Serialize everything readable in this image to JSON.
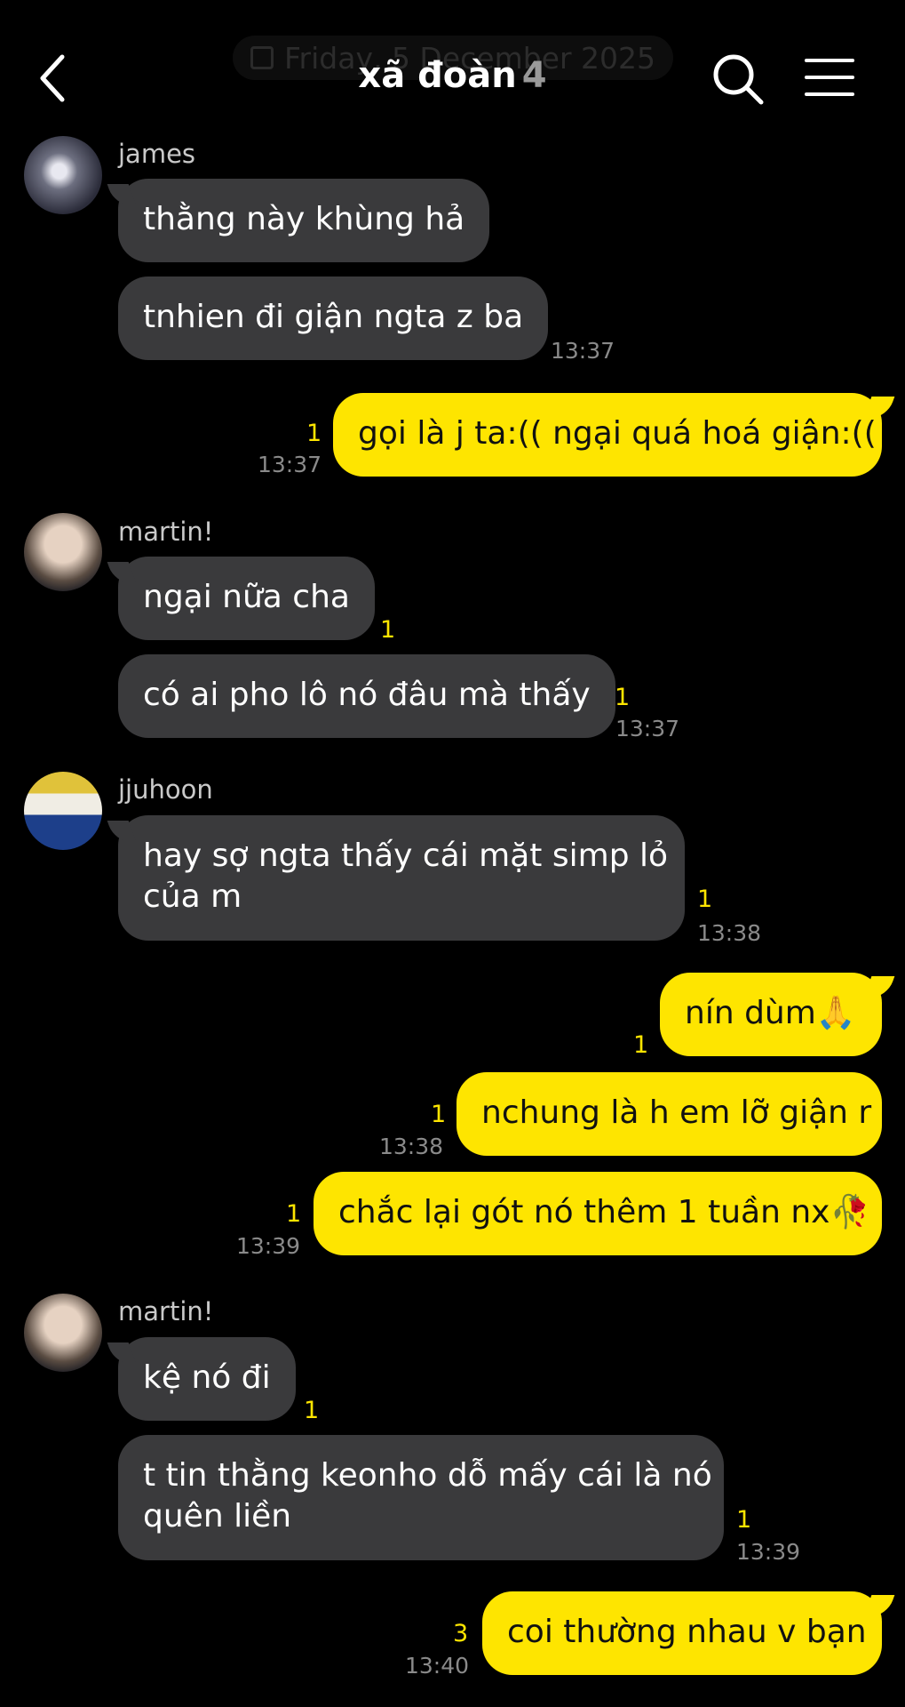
{
  "header": {
    "date_label": "Friday, 5 December 2025",
    "title": "xã đoàn",
    "member_count": "4",
    "back_icon": "back-chevron-icon",
    "search_icon": "search-icon",
    "menu_icon": "hamburger-menu-icon"
  },
  "messages": {
    "james_name": "james",
    "m1": "thằng này khùng hả",
    "m2": "tnhien đi giận ngta z ba",
    "m2_time": "13:37",
    "m3": "gọi là j ta:(( ngại quá hoá giận:((",
    "m3_unread": "1",
    "m3_time": "13:37",
    "martin_name": "martin!",
    "m4": "ngại nữa cha",
    "m4_unread": "1",
    "m5": "có ai pho lô nó đâu mà thấy",
    "m5_unread": "1",
    "m5_time": "13:37",
    "jjuhoon_name": "jjuhoon",
    "m6_line1": "hay sợ ngta thấy cái mặt simp lỏ",
    "m6_line2": "của m",
    "m6_unread": "1",
    "m6_time": "13:38",
    "m7": "nín dùm🙏",
    "m7_unread": "1",
    "m8": "nchung là h em lỡ giận r",
    "m8_unread": "1",
    "m8_time": "13:38",
    "m9": "chắc lại gót nó thêm 1 tuần nx🥀",
    "m9_unread": "1",
    "m9_time": "13:39",
    "martin2_name": "martin!",
    "m10": "kệ nó đi",
    "m10_unread": "1",
    "m11_line1": "t tin thằng keonho dỗ mấy cái là nó",
    "m11_line2": "quên liền",
    "m11_unread": "1",
    "m11_time": "13:39",
    "m12": "coi thường nhau v bạn",
    "m12_unread": "3",
    "m12_time": "13:40"
  },
  "colors": {
    "background": "#000000",
    "incoming_bubble": "#3a3a3c",
    "outgoing_bubble": "#fee500",
    "unread_count": "#fee500"
  }
}
